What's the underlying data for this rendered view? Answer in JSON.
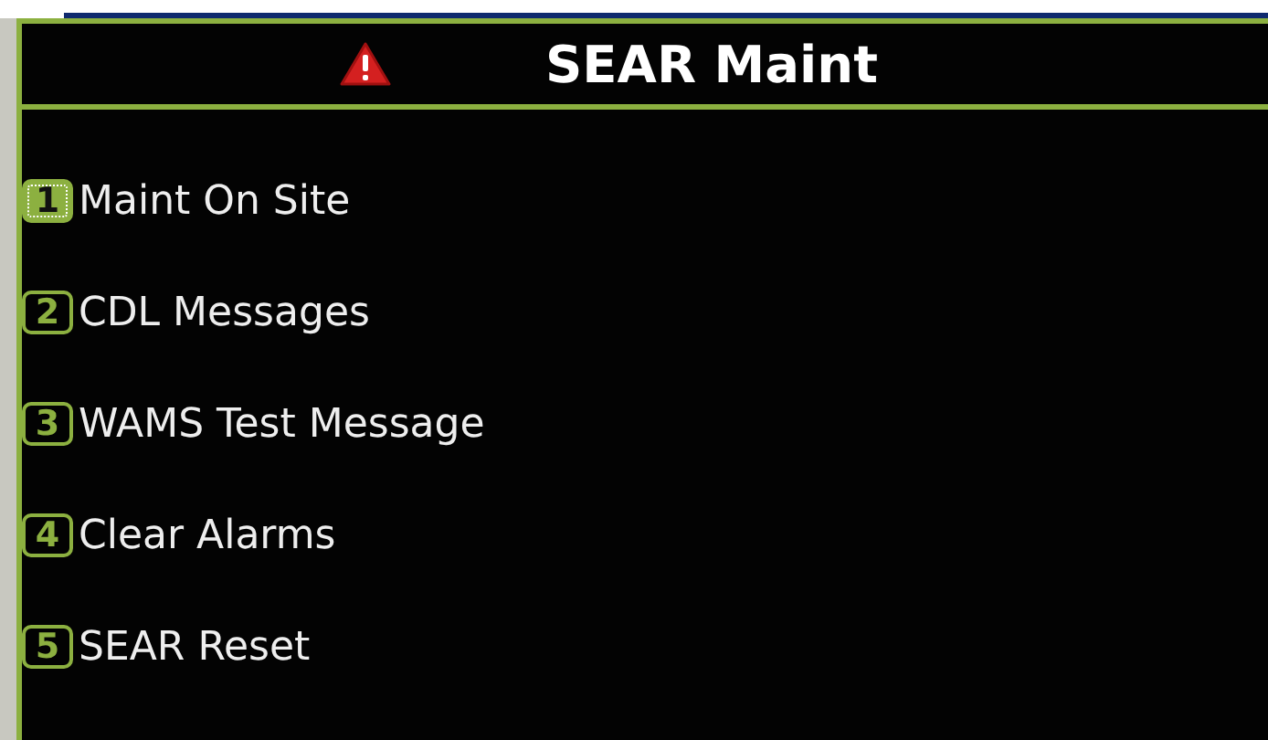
{
  "header": {
    "title": "SEAR Maint",
    "alarm": true
  },
  "menu": [
    {
      "key": "1",
      "label": "Maint On Site",
      "selected": true
    },
    {
      "key": "2",
      "label": "CDL Messages",
      "selected": false
    },
    {
      "key": "3",
      "label": "WAMS Test Message",
      "selected": false
    },
    {
      "key": "4",
      "label": "Clear Alarms",
      "selected": false
    },
    {
      "key": "5",
      "label": "SEAR Reset",
      "selected": false
    }
  ]
}
